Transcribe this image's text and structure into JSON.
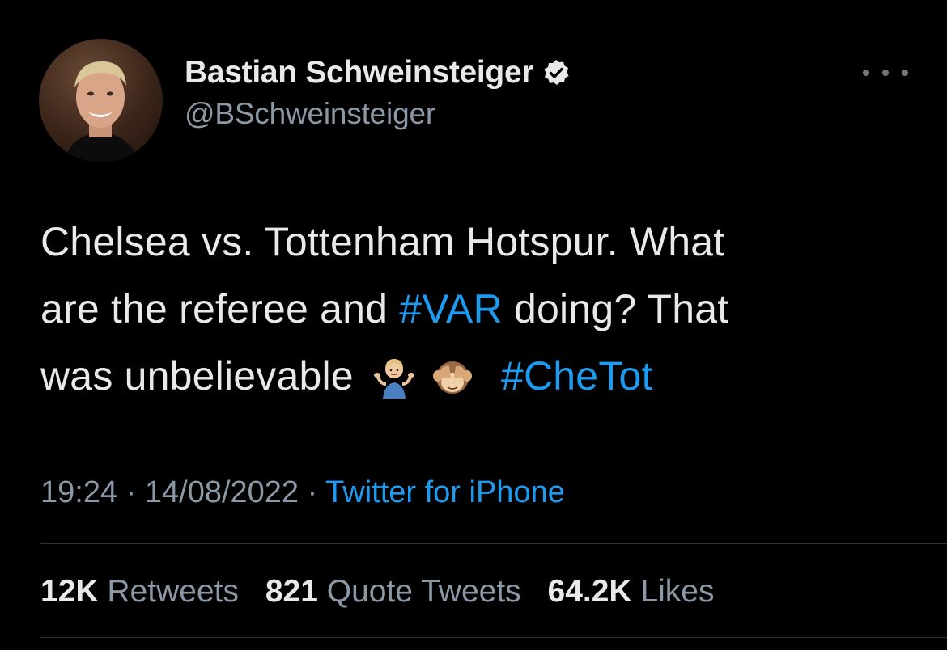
{
  "author": {
    "display_name": "Bastian Schweinsteiger",
    "handle": "@BSchweinsteiger",
    "verified": true
  },
  "tweet": {
    "lines": [
      [
        {
          "text": "Chelsea vs. Tottenham Hotspur. What",
          "type": "text"
        }
      ],
      [
        {
          "text": "are the referee and ",
          "type": "text"
        },
        {
          "text": "#VAR",
          "type": "hashtag"
        },
        {
          "text": " doing? That",
          "type": "text"
        }
      ],
      [
        {
          "text": "was unbelievable ",
          "type": "text"
        }
      ]
    ],
    "emoji": [
      "man-shrugging-emoji",
      "see-no-evil-monkey-emoji"
    ],
    "trailing_hashtag": "#CheTot"
  },
  "meta": {
    "time": "19:24",
    "separator": "·",
    "date": "14/08/2022",
    "source": "Twitter for iPhone"
  },
  "stats": {
    "retweets_count": "12K",
    "retweets_label": "Retweets",
    "quotes_count": "821",
    "quotes_label": "Quote Tweets",
    "likes_count": "64.2K",
    "likes_label": "Likes"
  },
  "colors": {
    "background": "#000000",
    "text": "#e7e9ea",
    "secondary": "#8b98a5",
    "link": "#1d9bf0"
  }
}
